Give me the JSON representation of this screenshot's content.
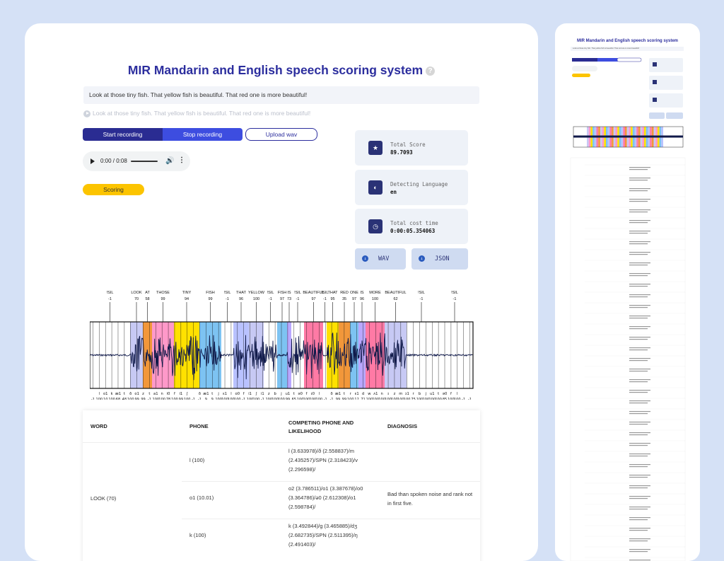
{
  "app": {
    "title": "MIR Mandarin and English speech scoring system",
    "help_icon": "help-circle-icon"
  },
  "input": {
    "text": "Look at those tiny fish. That yellow fish is beautiful. That red one is more beautiful!"
  },
  "reference": {
    "text": "Look at those tiny fish. That yellow fish is beautiful. That red one is more beautiful!"
  },
  "buttons": {
    "start": "Start recording",
    "stop": "Stop recording",
    "upload": "Upload wav",
    "score": "Scoring"
  },
  "player": {
    "time": "0:00 / 0:08",
    "progress": 0
  },
  "stats": [
    {
      "label": "Total Score",
      "value": "89.7093",
      "icon": "star-icon"
    },
    {
      "label": "Detecting Language",
      "value": "en",
      "icon": "language-icon"
    },
    {
      "label": "Total cost time",
      "value": "0:00:05.354063",
      "icon": "clock-icon"
    }
  ],
  "downloads": {
    "wav": "WAV",
    "json": "JSON",
    "icon": "download-icon"
  },
  "waveform": {
    "words": [
      {
        "w": "!SIL",
        "s": "-1"
      },
      {
        "w": "LOOK",
        "s": "70"
      },
      {
        "w": "AT",
        "s": "58"
      },
      {
        "w": "THOSE",
        "s": "99"
      },
      {
        "w": "TINY",
        "s": "94"
      },
      {
        "w": "FISH",
        "s": "99"
      },
      {
        "w": "!SIL",
        "s": "-1"
      },
      {
        "w": "THAT",
        "s": "96"
      },
      {
        "w": "YELLOW",
        "s": "100"
      },
      {
        "w": "!SIL",
        "s": "-1"
      },
      {
        "w": "FISH",
        "s": "97"
      },
      {
        "w": "IS",
        "s": "73"
      },
      {
        "w": "!SIL",
        "s": "-1"
      },
      {
        "w": "BEAUTIFUL",
        "s": "97"
      },
      {
        "w": "!SIL",
        "s": "-1"
      },
      {
        "w": "THAT",
        "s": "95"
      },
      {
        "w": "RED",
        "s": "35"
      },
      {
        "w": "ONE",
        "s": "97"
      },
      {
        "w": "IS",
        "s": "96"
      },
      {
        "w": "MORE",
        "s": "100"
      },
      {
        "w": "BEAUTIFUL",
        "s": "62"
      },
      {
        "w": "!SIL",
        "s": "-1"
      },
      {
        "w": "!SIL",
        "s": "-1"
      }
    ],
    "phones": [
      {
        "p": "",
        "s": "-1"
      },
      {
        "p": "l",
        "s": "100"
      },
      {
        "p": "o1",
        "s": "10"
      },
      {
        "p": "k",
        "s": "100"
      },
      {
        "p": "æ1",
        "s": "68"
      },
      {
        "p": "t",
        "s": "48"
      },
      {
        "p": "ð",
        "s": "100"
      },
      {
        "p": "o1",
        "s": "99"
      },
      {
        "p": "z",
        "s": "99"
      },
      {
        "p": "t",
        "s": "-1"
      },
      {
        "p": "a1",
        "s": "100"
      },
      {
        "p": "n",
        "s": "100"
      },
      {
        "p": "i0",
        "s": "78"
      },
      {
        "p": "f",
        "s": "100"
      },
      {
        "p": "i1",
        "s": "99"
      },
      {
        "p": "ʃ",
        "s": "100"
      },
      {
        "p": "",
        "s": "-1"
      },
      {
        "p": "ð",
        "s": "-1"
      },
      {
        "p": "æ1",
        "s": "9"
      },
      {
        "p": "t",
        "s": "9"
      },
      {
        "p": "j",
        "s": "100"
      },
      {
        "p": "ɛ1",
        "s": "100"
      },
      {
        "p": "l",
        "s": "100"
      },
      {
        "p": "o0",
        "s": "100"
      },
      {
        "p": "f",
        "s": "-1"
      },
      {
        "p": "i1",
        "s": "100"
      },
      {
        "p": "ʃ",
        "s": "100"
      },
      {
        "p": "i1",
        "s": "-1"
      },
      {
        "p": "z",
        "s": "100"
      },
      {
        "p": "b",
        "s": "100"
      },
      {
        "p": "j",
        "s": "100"
      },
      {
        "p": "u1",
        "s": "99"
      },
      {
        "p": "t",
        "s": "65"
      },
      {
        "p": "ə0",
        "s": "100"
      },
      {
        "p": "f",
        "s": "100"
      },
      {
        "p": "ɪ0",
        "s": "100"
      },
      {
        "p": "l",
        "s": "100"
      },
      {
        "p": "",
        "s": "-1"
      },
      {
        "p": "ð",
        "s": "-1"
      },
      {
        "p": "æ1",
        "s": "99"
      },
      {
        "p": "t",
        "s": "99"
      },
      {
        "p": "r",
        "s": "100"
      },
      {
        "p": "ɛ1",
        "s": "12"
      },
      {
        "p": "d",
        "s": "71"
      },
      {
        "p": "w",
        "s": "100"
      },
      {
        "p": "ʌ1",
        "s": "100"
      },
      {
        "p": "n",
        "s": "100"
      },
      {
        "p": "ɪ",
        "s": "100"
      },
      {
        "p": "z",
        "s": "100"
      },
      {
        "p": "m",
        "s": "100"
      },
      {
        "p": "ɔ1",
        "s": "100"
      },
      {
        "p": "r",
        "s": "75"
      },
      {
        "p": "b",
        "s": "100"
      },
      {
        "p": "j",
        "s": "100"
      },
      {
        "p": "u1",
        "s": "100"
      },
      {
        "p": "t",
        "s": "100"
      },
      {
        "p": "ə0",
        "s": "85"
      },
      {
        "p": "f",
        "s": "100"
      },
      {
        "p": "l",
        "s": "100"
      },
      {
        "p": "",
        "s": "-1"
      },
      {
        "p": "",
        "s": "-1"
      }
    ],
    "colors": [
      "#ffffff",
      "#c7c9f4",
      "#f2973a",
      "#ff99c9",
      "#ffe100",
      "#7dc3f2",
      "#ffffff",
      "#b9c2ff",
      "#c7c9f4",
      "#ffffff",
      "#7dc3f2",
      "#b9a7ff",
      "#ffffff",
      "#ff7aa5",
      "#ffffff",
      "#ffe100",
      "#f2973a",
      "#7dc3f2",
      "#b9a7ff",
      "#ff7aa5",
      "#c7c9f4",
      "#ffffff",
      "#ffffff"
    ]
  },
  "table": {
    "headers": [
      "WORD",
      "PHONE",
      "COMPETING PHONE AND LIKELIHOOD",
      "DIAGNOSIS"
    ],
    "rows": [
      {
        "word": "LOOK (70)",
        "phone": "l (100)",
        "competing": "l (3.633978)/ð (2.558837)/m (2.435257)/SPN (2.318423)/v (2.296598)/",
        "diagnosis": ""
      },
      {
        "word": "",
        "phone": "o1 (10.01)",
        "competing": "o2 (3.786511)/o1 (3.387678)/o0 (3.364786)/ə0 (2.612308)/o1 (2.598784)/",
        "diagnosis": "Bad than spoken noise and rank not in first five."
      },
      {
        "word": "",
        "phone": "k (100)",
        "competing": "k (3.492844)/g (3.465885)/dʒ (2.682735)/SPN (2.511395)/ŋ (2.491403)/",
        "diagnosis": ""
      }
    ]
  },
  "side_panel": {
    "title": "MIR Mandarin and English speech scoring system",
    "text": "Look at those tiny fish. That yellow fish is beautiful. That red one is more beautiful!"
  }
}
